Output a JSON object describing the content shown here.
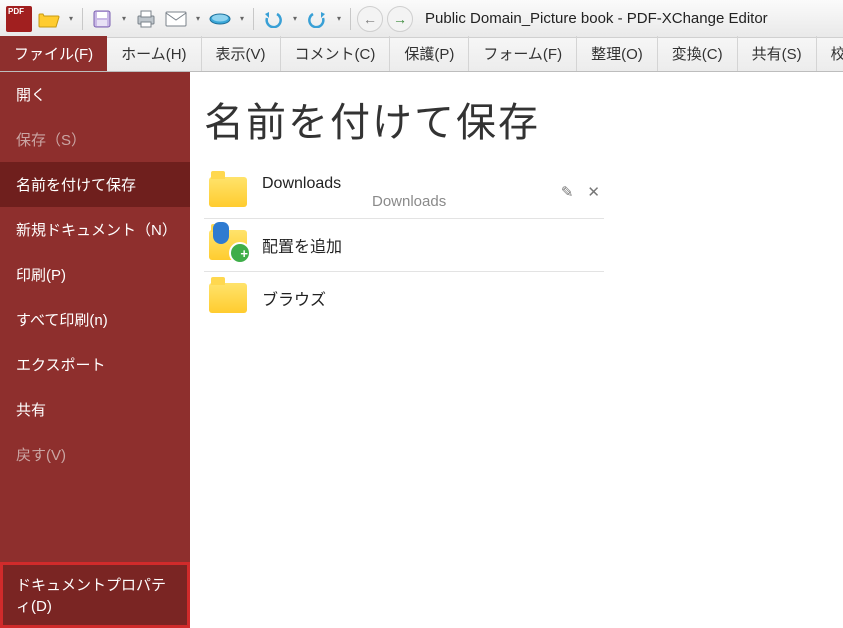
{
  "title": "Public Domain_Picture book - PDF-XChange Editor",
  "tabs": [
    "ファイル(F)",
    "ホーム(H)",
    "表示(V)",
    "コメント(C)",
    "保護(P)",
    "フォーム(F)",
    "整理(O)",
    "変換(C)",
    "共有(S)",
    "校閲"
  ],
  "side": {
    "open": "開く",
    "save_disabled": "保存（S）",
    "save_as": "名前を付けて保存",
    "new_doc": "新規ドキュメント（N）",
    "print": "印刷(P)",
    "print_all": "すべて印刷(n)",
    "export": "エクスポート",
    "share": "共有",
    "revert_disabled": "戻す(V)",
    "doc_props": "ドキュメントプロパティ(D)"
  },
  "content": {
    "heading": "名前を付けて保存",
    "downloads_title": "Downloads",
    "downloads_sub": "Downloads",
    "edit_glyph": "✎",
    "close_glyph": "✕",
    "add_place": "配置を追加",
    "browse": "ブラウズ"
  }
}
